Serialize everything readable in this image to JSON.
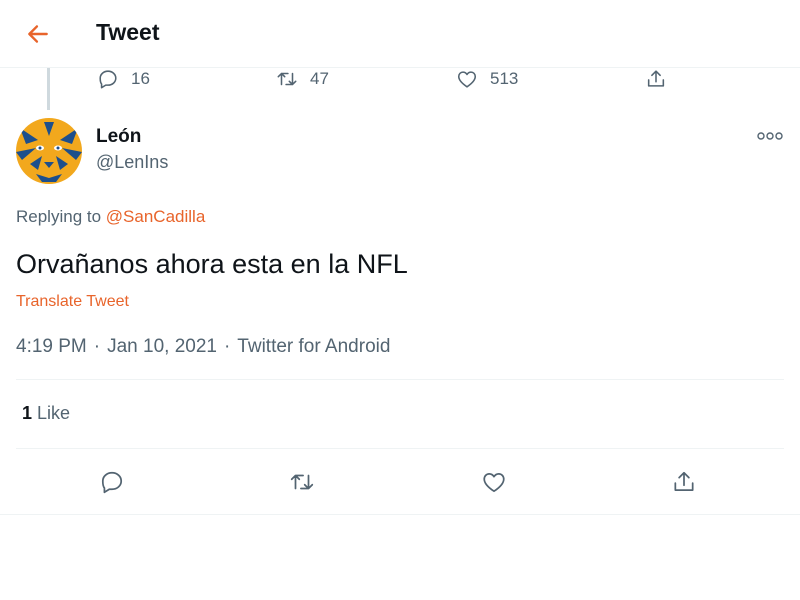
{
  "header": {
    "title": "Tweet",
    "back_icon": "arrow-left-icon",
    "accent": "#e8642b"
  },
  "parent_tweet": {
    "reply_count": "16",
    "retweet_count": "47",
    "like_count": "513"
  },
  "tweet": {
    "author": {
      "name": "León",
      "handle": "@LenIns",
      "avatar_colors": [
        "#f2a81d",
        "#1d4f8c",
        "#ffffff"
      ]
    },
    "replying_prefix": "Replying to",
    "replying_to": "@SanCadilla",
    "text": "Orvañanos ahora esta en la NFL",
    "translate_label": "Translate Tweet",
    "time": "4:19 PM",
    "date": "Jan 10, 2021",
    "separator": "·",
    "source": "Twitter for Android",
    "likes_count": "1",
    "likes_label": "Like"
  },
  "colors": {
    "text": "#0f1419",
    "muted": "#536471",
    "link": "#e8642b",
    "border": "#eff3f4"
  },
  "icons": [
    "arrow-left-icon",
    "reply-icon",
    "retweet-icon",
    "heart-icon",
    "share-icon",
    "more-icon"
  ]
}
